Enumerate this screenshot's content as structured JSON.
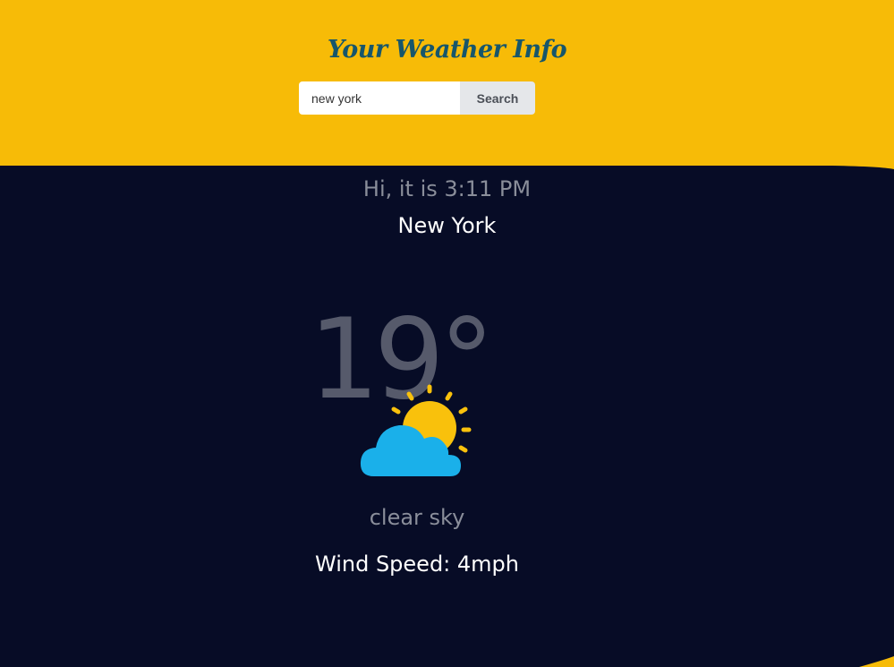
{
  "header": {
    "title": "Your Weather Info"
  },
  "search": {
    "value": "new york",
    "button_label": "Search"
  },
  "weather": {
    "greeting": "Hi, it is 3:11 PM",
    "city": "New York",
    "temperature": "19°",
    "icon": "partly-cloudy-icon",
    "description": "clear sky",
    "wind": "Wind Speed: 4mph"
  },
  "colors": {
    "header_bg": "#F7BB07",
    "panel_bg": "#070C26",
    "title": "#17566B",
    "sun": "#F9C10C",
    "cloud": "#1AB0EA"
  }
}
